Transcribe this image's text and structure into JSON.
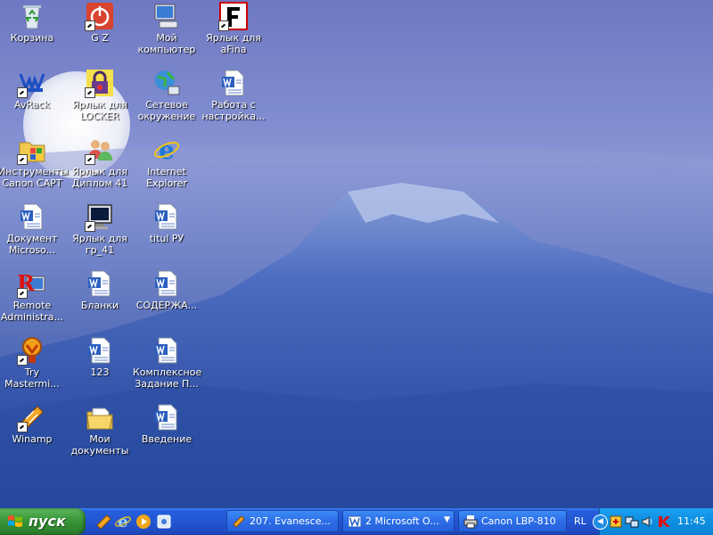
{
  "desktop": {
    "icons": [
      {
        "label": "Корзина",
        "icon": "recycle-bin-icon"
      },
      {
        "label": "G Z",
        "icon": "power-app-icon"
      },
      {
        "label": "Мой компьютер",
        "icon": "my-computer-icon"
      },
      {
        "label": "Ярлык для aFina",
        "icon": "afina-icon"
      },
      {
        "label": "AvRack",
        "icon": "avrack-icon"
      },
      {
        "label": "Ярлык для LOCKER",
        "icon": "locker-icon"
      },
      {
        "label": "Сетевое окружение",
        "icon": "network-icon"
      },
      {
        "label": "Работа с настройка...",
        "icon": "word-document-icon"
      },
      {
        "label": "Инструменты Canon CAPT",
        "icon": "canon-tools-icon"
      },
      {
        "label": "Ярлык для Диплом 41",
        "icon": "users-icon"
      },
      {
        "label": "Internet Explorer",
        "icon": "internet-explorer-icon"
      },
      {
        "label": "Документ Microso...",
        "icon": "word-document-icon"
      },
      {
        "label": "Ярлык для гр_41",
        "icon": "monitor-icon"
      },
      {
        "label": "titul РУ",
        "icon": "word-document-icon"
      },
      {
        "label": "Remote Administra...",
        "icon": "remote-admin-icon"
      },
      {
        "label": "Бланки",
        "icon": "word-document-icon"
      },
      {
        "label": "СОДЕРЖА...",
        "icon": "word-document-icon"
      },
      {
        "label": "Try Mastermi...",
        "icon": "mastermind-icon"
      },
      {
        "label": "123",
        "icon": "word-document-icon"
      },
      {
        "label": "Комплексное Задание П...",
        "icon": "word-document-icon"
      },
      {
        "label": "Winamp",
        "icon": "winamp-icon"
      },
      {
        "label": "Мои документы",
        "icon": "my-documents-icon"
      },
      {
        "label": "Введение",
        "icon": "word-document-icon"
      }
    ]
  },
  "taskbar": {
    "start_label": "пуск",
    "quick_launch": [
      "winamp-icon",
      "internet-explorer-icon",
      "media-player-icon",
      "show-desktop-icon"
    ],
    "buttons": [
      {
        "label": "207. Evanesce...",
        "icon": "winamp-icon"
      },
      {
        "label": "2 Microsoft O...",
        "icon": "word-icon"
      },
      {
        "label": "Canon LBP-810",
        "icon": "printer-icon"
      }
    ],
    "language": "RL",
    "clock": "11:45"
  },
  "colors": {
    "taskbar_blue": "#245edb",
    "start_green": "#3c9a3c",
    "tray_blue": "#0c8ee0"
  }
}
